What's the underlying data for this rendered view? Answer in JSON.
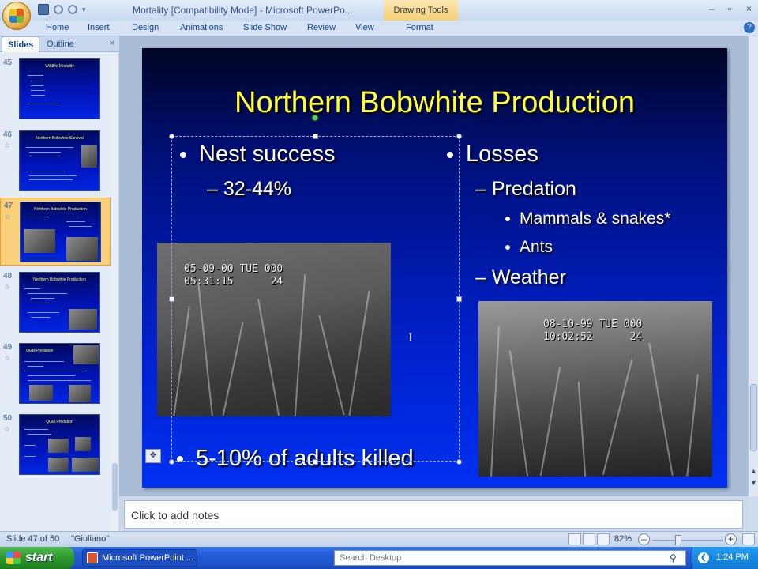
{
  "window": {
    "title": "Mortality [Compatibility Mode] - Microsoft PowerPo...",
    "context_tab": "Drawing Tools",
    "controls": [
      "–",
      "▫",
      "×"
    ]
  },
  "ribbon": {
    "tabs": [
      "Home",
      "Insert",
      "Design",
      "Animations",
      "Slide Show",
      "Review",
      "View",
      "Format"
    ]
  },
  "left_panel": {
    "tabs": [
      "Slides",
      "Outline"
    ],
    "close": "×",
    "thumbnails": [
      {
        "num": "45",
        "title": "Wildlife Mortality",
        "star": ""
      },
      {
        "num": "46",
        "title": "Northern Bobwhite Survival",
        "star": "☆"
      },
      {
        "num": "47",
        "title": "Northern Bobwhite Production",
        "star": "☆"
      },
      {
        "num": "48",
        "title": "Northern Bobwhite Production",
        "star": "☆"
      },
      {
        "num": "49",
        "title": "Quail Predation",
        "star": "☆"
      },
      {
        "num": "50",
        "title": "Quail Predation",
        "star": "☆"
      }
    ]
  },
  "slide": {
    "title": "Northern Bobwhite Production",
    "left_bullet": "Nest success",
    "left_sub": "32-44%",
    "bottom_bullet": "5-10% of adults killed",
    "right_bullet": "Losses",
    "right_sub1": "Predation",
    "right_sub1_items": [
      "Mammals & snakes*",
      "Ants"
    ],
    "right_sub2": "Weather",
    "photo1_stamp": "05-09-00 TUE 000\n05:31:15      24",
    "photo2_stamp": "08-10-99 TUE 000\n10:02:52      24",
    "cursor": "I"
  },
  "notes": {
    "placeholder": "Click to add notes"
  },
  "status": {
    "slide_counter": "Slide 47 of 50",
    "theme": "\"Giuliano\"",
    "zoom": "82%",
    "zoom_out": "–",
    "zoom_in": "+"
  },
  "taskbar": {
    "start": "start",
    "item": "Microsoft PowerPoint ...",
    "search_placeholder": "Search Desktop",
    "clock": "1:24 PM"
  }
}
